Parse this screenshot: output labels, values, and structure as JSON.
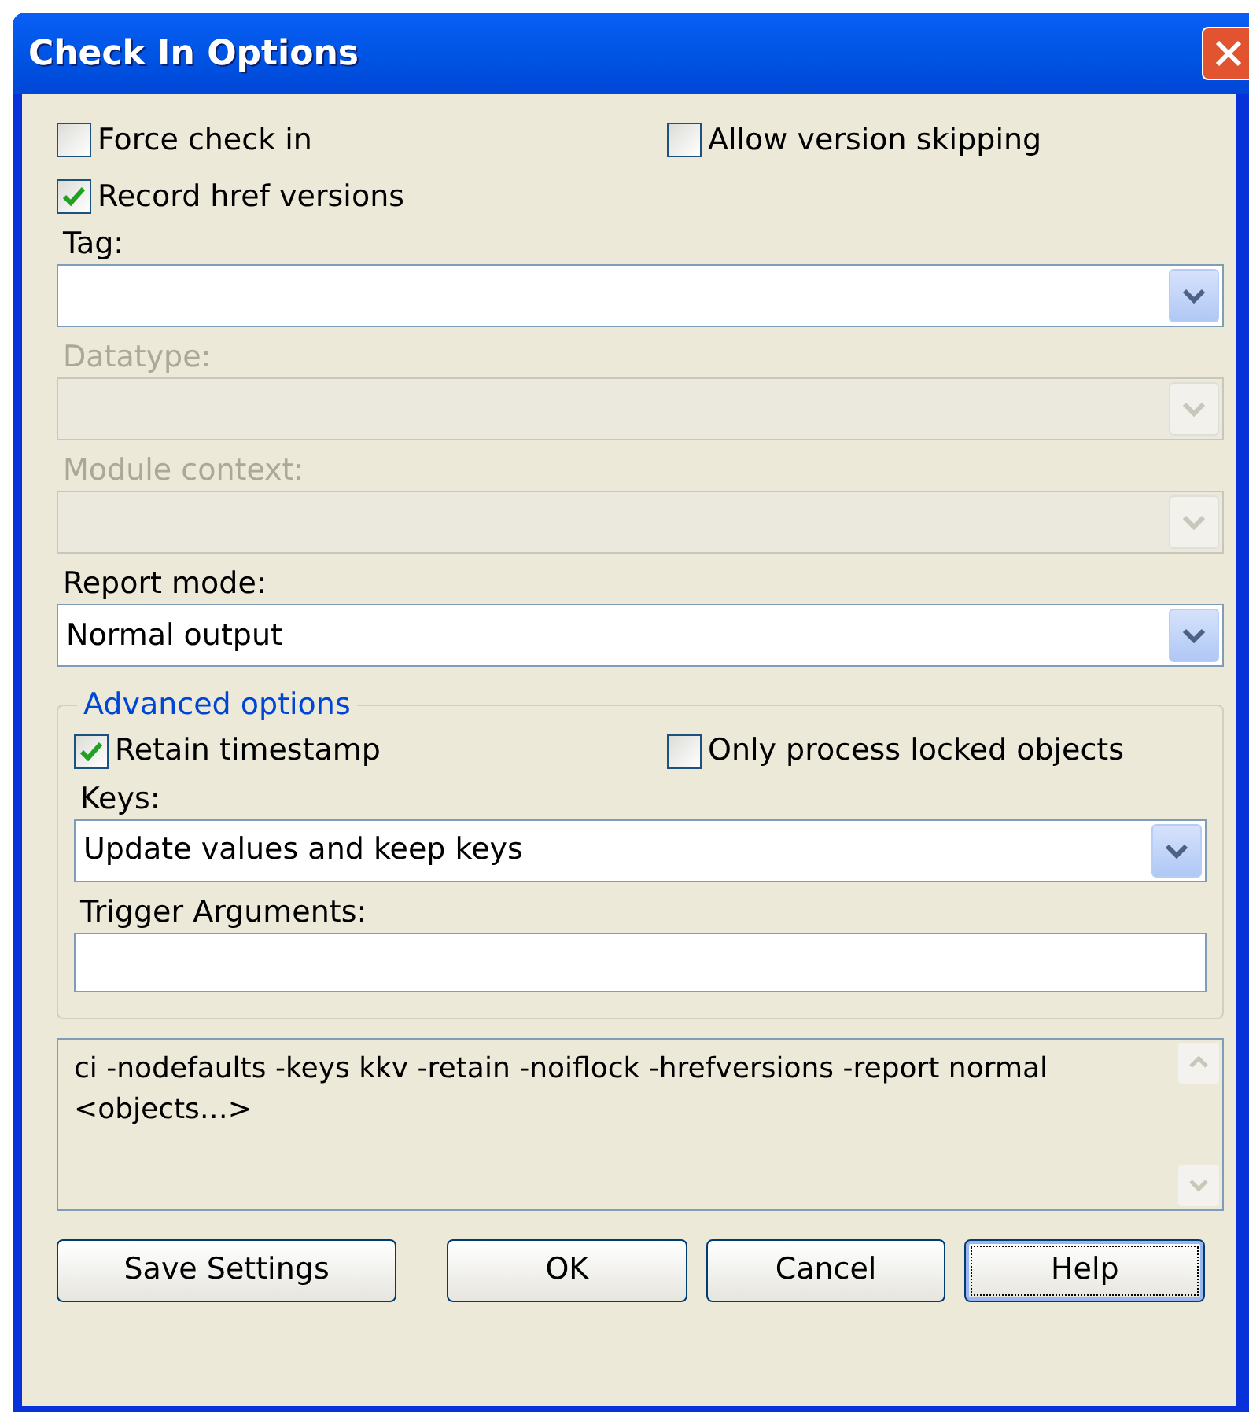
{
  "window": {
    "title": "Check In Options"
  },
  "options": [
    {
      "label": "Force check in",
      "checked": false
    },
    {
      "label": "Allow version skipping",
      "checked": false
    },
    {
      "label": "Record href versions",
      "checked": true
    }
  ],
  "fields": [
    {
      "kind": "combo",
      "label": "Tag:",
      "disabled": false
    },
    {
      "kind": "combo",
      "label": "Datatype:",
      "disabled": true
    },
    {
      "kind": "combo",
      "label": "Module context:",
      "disabled": true
    },
    {
      "kind": "combo",
      "label": "Report mode:",
      "disabled": false,
      "value": "Normal output"
    }
  ],
  "advanced": {
    "title": "Advanced options",
    "options": [
      {
        "label": "Retain timestamp",
        "checked": true
      },
      {
        "label": "Only process locked objects",
        "checked": false
      }
    ],
    "fields": [
      {
        "kind": "combo",
        "label": "Keys:",
        "disabled": false,
        "value": "Update values and keep keys"
      },
      {
        "kind": "text",
        "label": "Trigger Arguments:",
        "disabled": false
      }
    ]
  },
  "command": {
    "text": "ci -nodefaults -keys kkv -retain -noiflock -hrefversions -report normal <objects…>"
  },
  "buttons": [
    {
      "label": "Save Settings",
      "focused": false
    },
    {
      "label": "OK",
      "focused": false
    },
    {
      "label": "Cancel",
      "focused": false
    },
    {
      "label": "Help",
      "focused": true
    }
  ]
}
